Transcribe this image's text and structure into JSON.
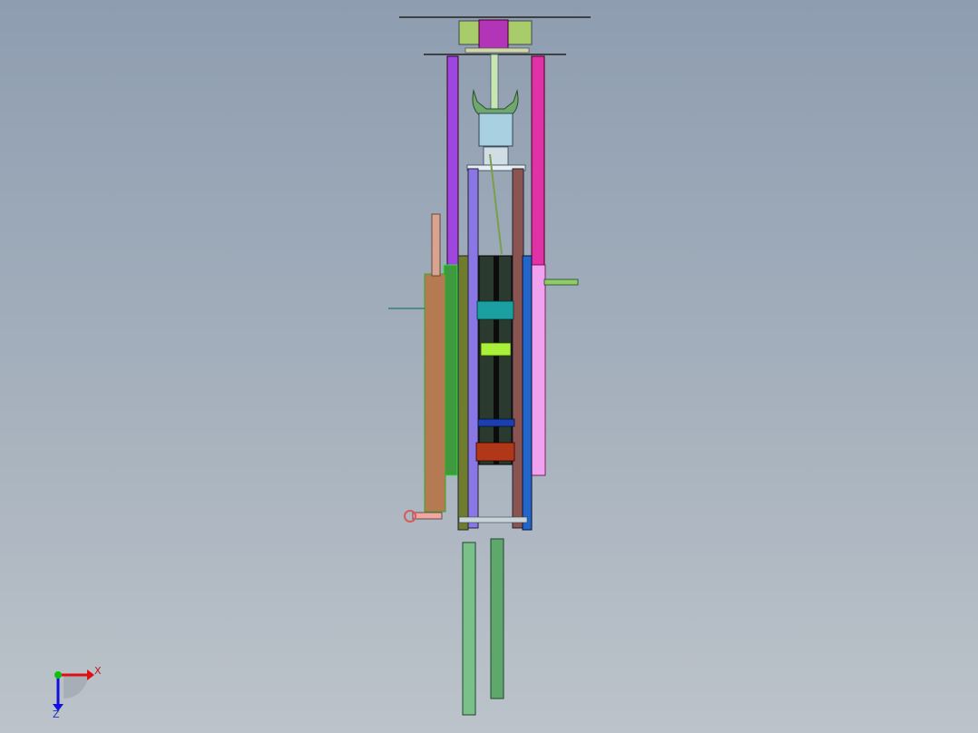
{
  "view": {
    "background_top": "#8e9db0",
    "background_bottom": "#bcc3ca"
  },
  "model": {
    "description_icon": "cad-assembly-front-view"
  },
  "triad": {
    "x_label": "X",
    "z_label": "Z",
    "x_color": "#e01010",
    "z_color": "#1010e0",
    "y_color": "#10c010"
  }
}
